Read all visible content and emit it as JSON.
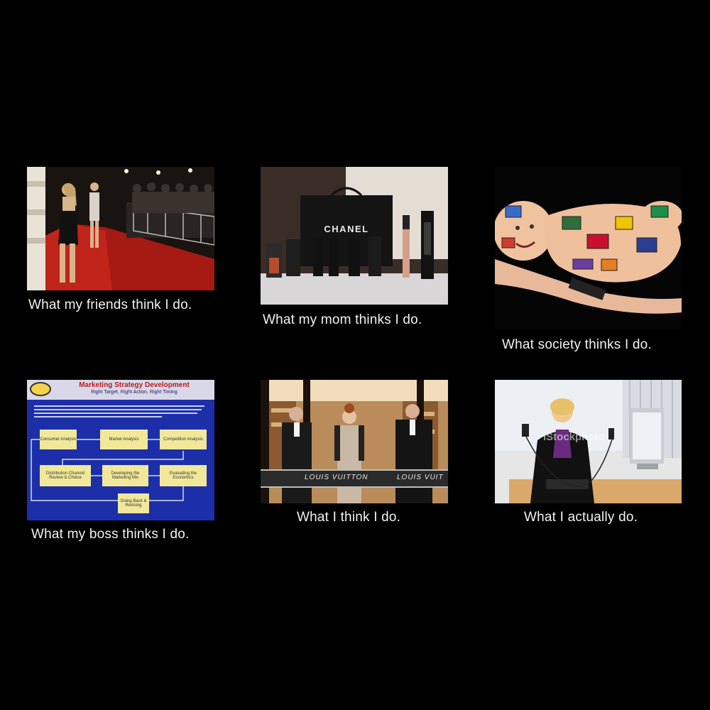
{
  "panels": [
    {
      "caption": "What my friends think I do."
    },
    {
      "caption": "What my mom thinks I do.",
      "brand": "CHANEL"
    },
    {
      "caption": "What society thinks I do."
    },
    {
      "caption": "What my boss thinks I do.",
      "diagram": {
        "title": "Marketing Strategy Development",
        "subtitle": "Right Target, Right Action, Right Timing",
        "boxes": {
          "consumer": "Consumer Analysis",
          "market": "Market Analysis",
          "competition": "Competition Analysis",
          "distribution": "Distribution Channel Review & Choice",
          "developing": "Developing the Marketing Mix",
          "evaluating": "Evaluating the Economics",
          "going_back": "Going Back & Revising"
        }
      }
    },
    {
      "caption": "What I think I do.",
      "ribbon_text": "LOUIS VUITTON",
      "ribbon_text_2": "LOUIS VUIT"
    },
    {
      "caption": "What I actually do.",
      "watermark": "iStockphoto"
    }
  ]
}
